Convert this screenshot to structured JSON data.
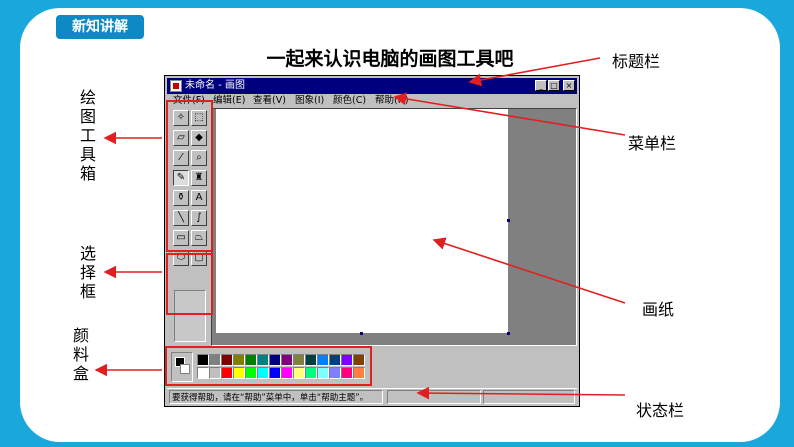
{
  "slide": {
    "tag": "新知讲解",
    "title": "一起来认识电脑的画图工具吧"
  },
  "window": {
    "title": "未命名 - 画图",
    "buttons": {
      "minimize": "_",
      "maximize": "□",
      "close": "×"
    },
    "menu": [
      "文件(F)",
      "编辑(E)",
      "查看(V)",
      "图象(I)",
      "颜色(C)",
      "帮助(H)"
    ],
    "tools": [
      {
        "name": "free-select-tool",
        "glyph": "✧"
      },
      {
        "name": "rect-select-tool",
        "glyph": "⬚"
      },
      {
        "name": "eraser-tool",
        "glyph": "▱"
      },
      {
        "name": "fill-tool",
        "glyph": "◆"
      },
      {
        "name": "color-picker-tool",
        "glyph": "⁄"
      },
      {
        "name": "magnifier-tool",
        "glyph": "⌕"
      },
      {
        "name": "pencil-tool",
        "glyph": "✎"
      },
      {
        "name": "brush-tool",
        "glyph": "♜"
      },
      {
        "name": "airbrush-tool",
        "glyph": "⚱"
      },
      {
        "name": "text-tool",
        "glyph": "A"
      },
      {
        "name": "line-tool",
        "glyph": "╲"
      },
      {
        "name": "curve-tool",
        "glyph": "∫"
      },
      {
        "name": "rectangle-tool",
        "glyph": "▭"
      },
      {
        "name": "polygon-tool",
        "glyph": "⏢"
      },
      {
        "name": "ellipse-tool",
        "glyph": "⬭"
      },
      {
        "name": "rounded-rect-tool",
        "glyph": "▢"
      }
    ],
    "selected_tool": "pencil-tool",
    "palette_top": [
      "#000000",
      "#808080",
      "#800000",
      "#808000",
      "#008000",
      "#008080",
      "#000080",
      "#800080",
      "#808040",
      "#004040",
      "#0080ff",
      "#004080",
      "#8000ff",
      "#804000"
    ],
    "palette_bottom": [
      "#ffffff",
      "#c0c0c0",
      "#ff0000",
      "#ffff00",
      "#00ff00",
      "#00ffff",
      "#0000ff",
      "#ff00ff",
      "#ffff80",
      "#00ff80",
      "#80ffff",
      "#8080ff",
      "#ff0080",
      "#ff8040"
    ],
    "status_text": "要获得帮助，请在“帮助”菜单中，单击“帮助主题”。"
  },
  "annotations": {
    "title_bar": "标题栏",
    "menu_bar": "菜单栏",
    "toolbox": "绘图工具箱",
    "option_box": "选择框",
    "palette": "颜料盒",
    "canvas": "画纸",
    "status_bar": "状态栏"
  },
  "colors": {
    "accent": "#19a7dc",
    "highlight": "#e02020",
    "titlebar": "#00007f"
  }
}
